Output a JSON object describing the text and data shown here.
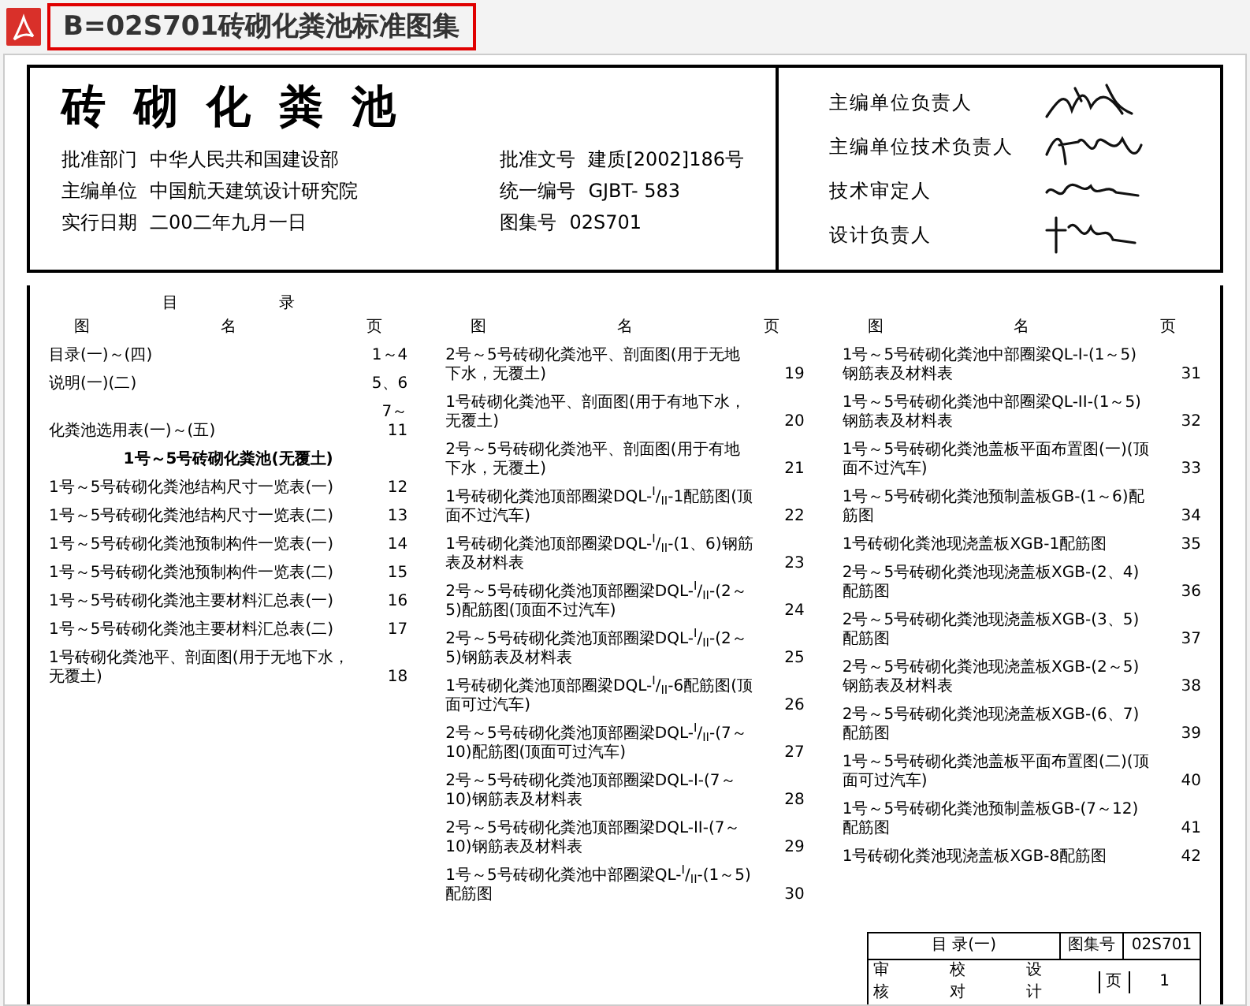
{
  "viewer": {
    "title": "B=02S701砖砌化粪池标准图集"
  },
  "document": {
    "title": "砖砌化粪池",
    "info": [
      [
        {
          "label": "批准部门",
          "value": "中华人民共和国建设部"
        },
        {
          "label": "批准文号",
          "value": "建质[2002]186号"
        }
      ],
      [
        {
          "label": "主编单位",
          "value": "中国航天建筑设计研究院"
        },
        {
          "label": "统一编号",
          "value": "GJBT- 583"
        }
      ],
      [
        {
          "label": "实行日期",
          "value": "二00二年九月一日"
        },
        {
          "label": "图集号",
          "value": "02S701"
        }
      ]
    ],
    "responsibles": [
      {
        "role": "主编单位负责人"
      },
      {
        "role": "主编单位技术负责人"
      },
      {
        "role": "技术审定人"
      },
      {
        "role": "设计负责人"
      }
    ]
  },
  "contents": {
    "title": [
      "目",
      "录"
    ],
    "columns": [
      {
        "headers": [
          "图",
          "名",
          "页"
        ],
        "entries": [
          {
            "kind": "entry",
            "name": "目录(一)～(四)",
            "page": "1～4"
          },
          {
            "kind": "entry",
            "name": "说明(一)(二)",
            "page": "5、6"
          },
          {
            "kind": "entry",
            "name": "化粪池选用表(一)～(五)",
            "page": "7～11"
          },
          {
            "kind": "section",
            "name": "1号～5号砖砌化粪池(无覆土)"
          },
          {
            "kind": "entry",
            "name": "1号～5号砖砌化粪池结构尺寸一览表(一)",
            "page": "12"
          },
          {
            "kind": "entry",
            "name": "1号～5号砖砌化粪池结构尺寸一览表(二)",
            "page": "13"
          },
          {
            "kind": "entry",
            "name": "1号～5号砖砌化粪池预制构件一览表(一)",
            "page": "14"
          },
          {
            "kind": "entry",
            "name": "1号～5号砖砌化粪池预制构件一览表(二)",
            "page": "15"
          },
          {
            "kind": "entry",
            "name": "1号～5号砖砌化粪池主要材料汇总表(一)",
            "page": "16"
          },
          {
            "kind": "entry",
            "name": "1号～5号砖砌化粪池主要材料汇总表(二)",
            "page": "17"
          },
          {
            "kind": "entry",
            "name": "1号砖砌化粪池平、剖面图(用于无地下水，无覆土)",
            "page": "18"
          }
        ]
      },
      {
        "headers": [
          "图",
          "名",
          "页"
        ],
        "entries": [
          {
            "kind": "entry",
            "name": "2号～5号砖砌化粪池平、剖面图(用于无地下水，无覆土)",
            "page": "19"
          },
          {
            "kind": "entry",
            "name": "1号砖砌化粪池平、剖面图(用于有地下水，无覆土)",
            "page": "20"
          },
          {
            "kind": "entry",
            "name": "2号～5号砖砌化粪池平、剖面图(用于有地下水，无覆土)",
            "page": "21"
          },
          {
            "kind": "entry",
            "name": "1号砖砌化粪池顶部圈梁DQL-$^{I}$/$_{II}$-1配筋图(顶面不过汽车)",
            "page": "22"
          },
          {
            "kind": "entry",
            "name": "1号砖砌化粪池顶部圈梁DQL-$^{I}$/$_{II}$-(1、6)钢筋表及材料表",
            "page": "23"
          },
          {
            "kind": "entry",
            "name": "2号～5号砖砌化粪池顶部圈梁DQL-$^{I}$/$_{II}$-(2～5)配筋图(顶面不过汽车)",
            "page": "24"
          },
          {
            "kind": "entry",
            "name": "2号～5号砖砌化粪池顶部圈梁DQL-$^{I}$/$_{II}$-(2～5)钢筋表及材料表",
            "page": "25"
          },
          {
            "kind": "entry",
            "name": "1号砖砌化粪池顶部圈梁DQL-$^{I}$/$_{II}$-6配筋图(顶面可过汽车)",
            "page": "26"
          },
          {
            "kind": "entry",
            "name": "2号～5号砖砌化粪池顶部圈梁DQL-$^{I}$/$_{II}$-(7～10)配筋图(顶面可过汽车)",
            "page": "27"
          },
          {
            "kind": "entry",
            "name": "2号～5号砖砌化粪池顶部圈梁DQL-I-(7～10)钢筋表及材料表",
            "page": "28"
          },
          {
            "kind": "entry",
            "name": "2号～5号砖砌化粪池顶部圈梁DQL-II-(7～10)钢筋表及材料表",
            "page": "29"
          },
          {
            "kind": "entry",
            "name": "1号～5号砖砌化粪池中部圈梁QL-$^{I}$/$_{II}$-(1～5)配筋图",
            "page": "30"
          }
        ]
      },
      {
        "headers": [
          "图",
          "名",
          "页"
        ],
        "entries": [
          {
            "kind": "entry",
            "name": "1号～5号砖砌化粪池中部圈梁QL-I-(1～5)钢筋表及材料表",
            "page": "31"
          },
          {
            "kind": "entry",
            "name": "1号～5号砖砌化粪池中部圈梁QL-II-(1～5)钢筋表及材料表",
            "page": "32"
          },
          {
            "kind": "entry",
            "name": "1号～5号砖砌化粪池盖板平面布置图(一)(顶面不过汽车)",
            "page": "33"
          },
          {
            "kind": "entry",
            "name": "1号～5号砖砌化粪池预制盖板GB-(1～6)配筋图",
            "page": "34"
          },
          {
            "kind": "entry",
            "name": "1号砖砌化粪池现浇盖板XGB-1配筋图",
            "page": "35"
          },
          {
            "kind": "entry",
            "name": "2号～5号砖砌化粪池现浇盖板XGB-(2、4)配筋图",
            "page": "36"
          },
          {
            "kind": "entry",
            "name": "2号～5号砖砌化粪池现浇盖板XGB-(3、5)配筋图",
            "page": "37"
          },
          {
            "kind": "entry",
            "name": "2号～5号砖砌化粪池现浇盖板XGB-(2～5)钢筋表及材料表",
            "page": "38"
          },
          {
            "kind": "entry",
            "name": "2号～5号砖砌化粪池现浇盖板XGB-(6、7)配筋图",
            "page": "39"
          },
          {
            "kind": "entry",
            "name": "1号～5号砖砌化粪池盖板平面布置图(二)(顶面可过汽车)",
            "page": "40"
          },
          {
            "kind": "entry",
            "name": "1号～5号砖砌化粪池预制盖板GB-(7～12)配筋图",
            "page": "41"
          },
          {
            "kind": "entry",
            "name": "1号砖砌化粪池现浇盖板XGB-8配筋图",
            "page": "42"
          }
        ]
      }
    ]
  },
  "title_block": {
    "title": "目 录(一)",
    "atlas_label": "图集号",
    "atlas_no": "02S701",
    "labels": [
      "审核",
      "校对",
      "设计"
    ],
    "page_label": "页",
    "page": "1"
  }
}
